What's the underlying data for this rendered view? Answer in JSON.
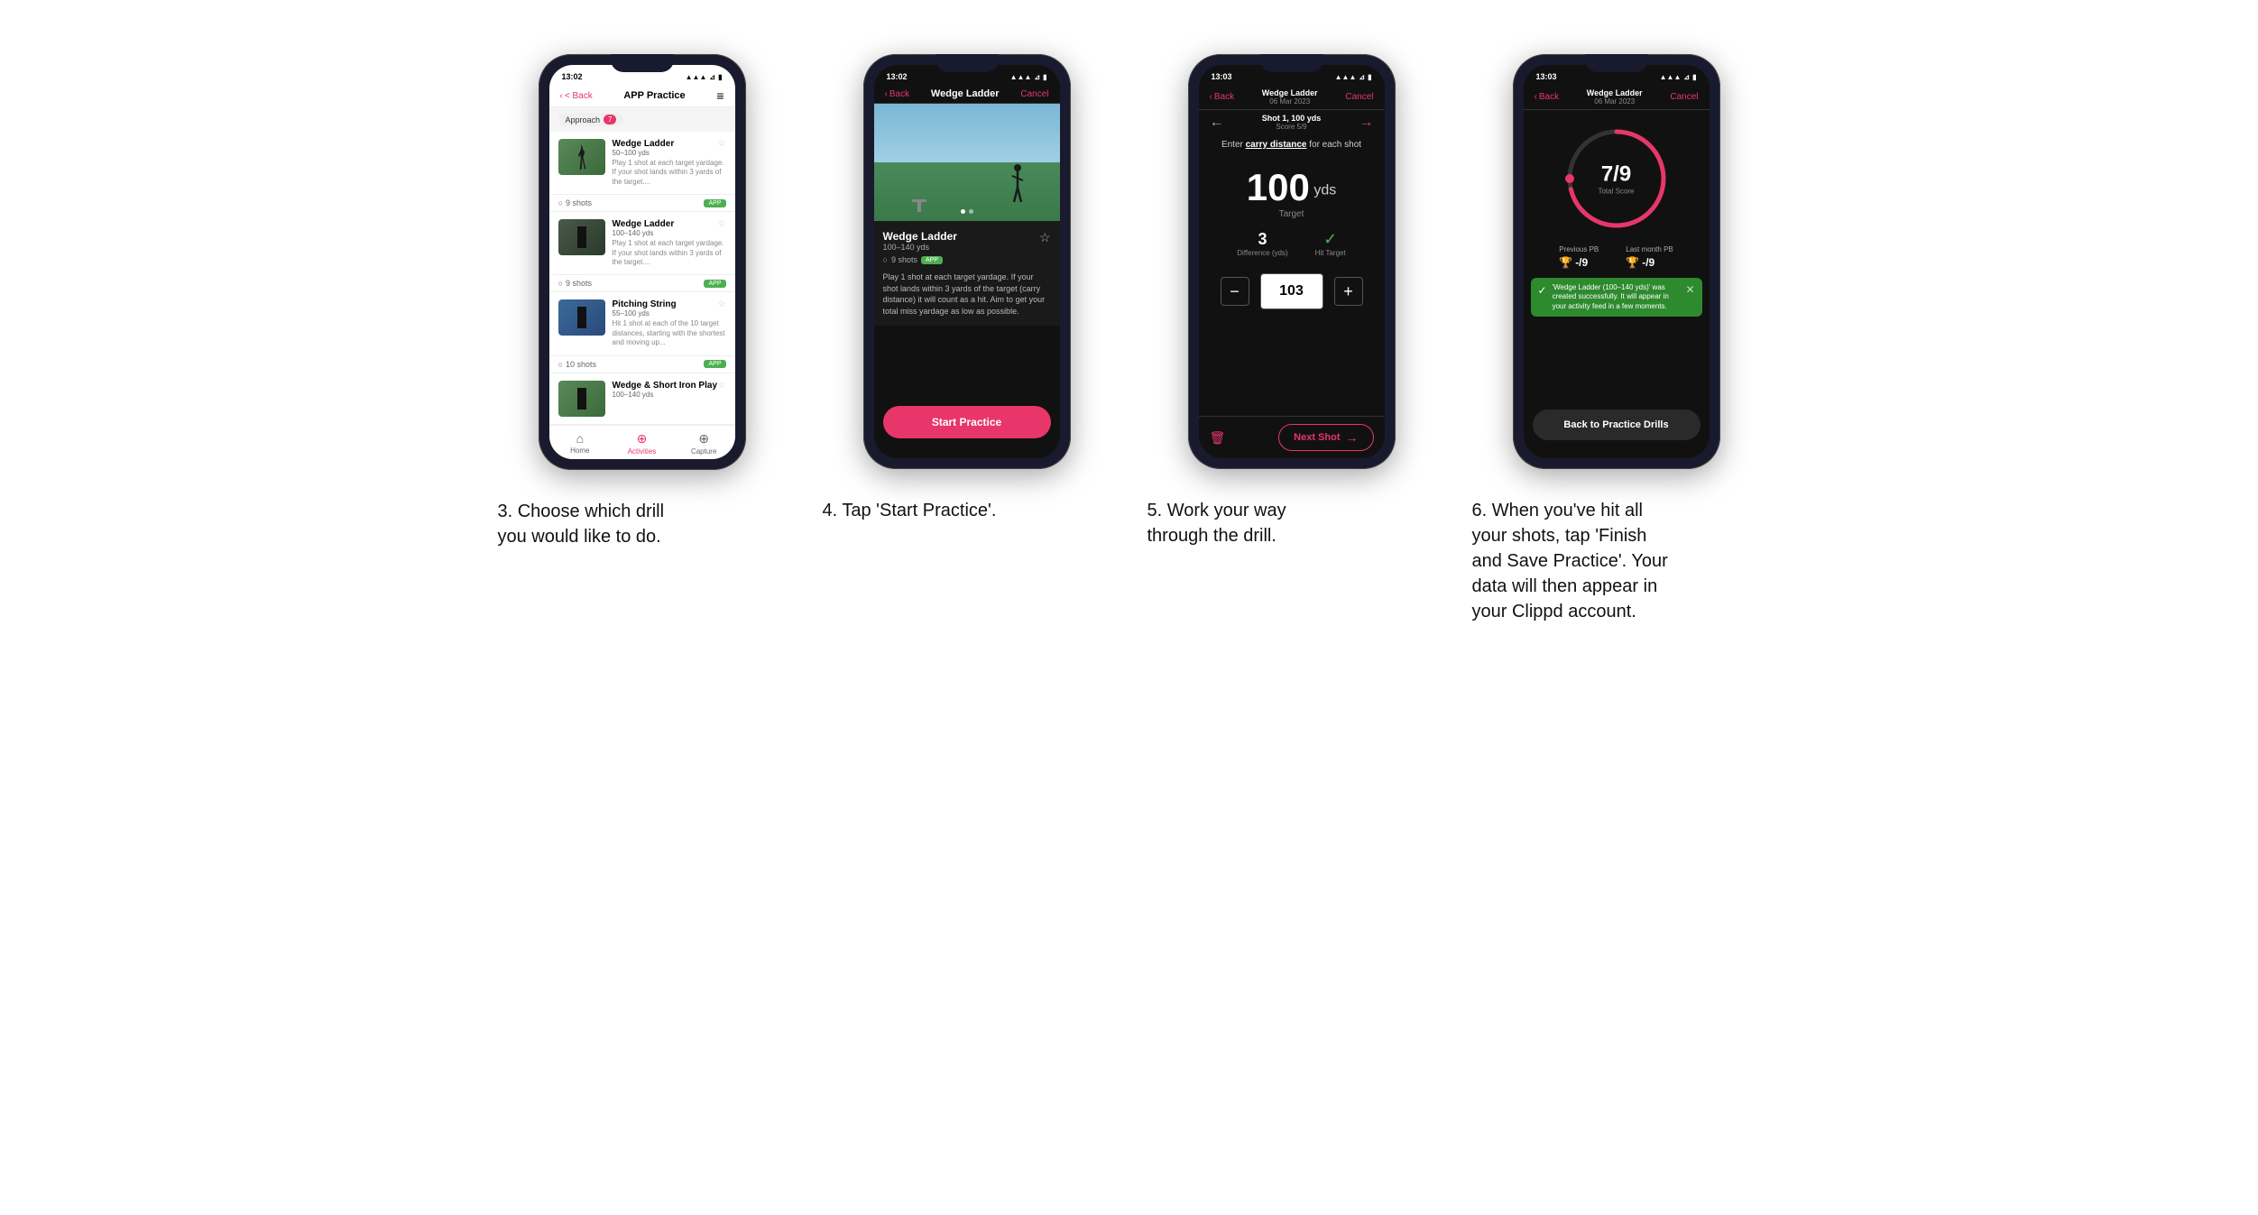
{
  "page": {
    "background": "#ffffff"
  },
  "step3": {
    "caption": "3. Choose which drill you would like to do.",
    "phone": {
      "time": "13:02",
      "nav": {
        "back": "< Back",
        "title": "APP Practice",
        "menu": "≡"
      },
      "category": {
        "label": "Approach",
        "count": "7"
      },
      "drills": [
        {
          "title": "Wedge Ladder",
          "range": "50–100 yds",
          "desc": "Play 1 shot at each target yardage. If your shot lands within 3 yards of the target....",
          "shots": "9 shots",
          "badge": "APP",
          "color": "green"
        },
        {
          "title": "Wedge Ladder",
          "range": "100–140 yds",
          "desc": "Play 1 shot at each target yardage. If your shot lands within 3 yards of the target....",
          "shots": "9 shots",
          "badge": "APP",
          "color": "dark"
        },
        {
          "title": "Pitching String",
          "range": "55–100 yds",
          "desc": "Hit 1 shot at each of the 10 target distances, starting with the shortest and moving up...",
          "shots": "10 shots",
          "badge": "APP",
          "color": "blue"
        },
        {
          "title": "Wedge & Short Iron Play",
          "range": "100–140 yds",
          "desc": "",
          "shots": "",
          "badge": "",
          "color": "green"
        }
      ],
      "bottomNav": [
        {
          "label": "Home",
          "icon": "⌂",
          "active": false
        },
        {
          "label": "Activities",
          "icon": "⊕",
          "active": true
        },
        {
          "label": "Capture",
          "icon": "⊕",
          "active": false
        }
      ]
    }
  },
  "step4": {
    "caption": "4. Tap 'Start Practice'.",
    "phone": {
      "time": "13:02",
      "nav": {
        "back": "< Back",
        "title": "Wedge Ladder",
        "action": "Cancel"
      },
      "drill": {
        "title": "Wedge Ladder",
        "range": "100–140 yds",
        "shots": "9 shots",
        "badge": "APP",
        "desc": "Play 1 shot at each target yardage. If your shot lands within 3 yards of the target (carry distance) it will count as a hit. Aim to get your total miss yardage as low as possible."
      },
      "startButton": "Start Practice"
    }
  },
  "step5": {
    "caption": "5. Work your way through the drill.",
    "phone": {
      "time": "13:03",
      "nav": {
        "back": "< Back",
        "titleLine1": "Wedge Ladder",
        "titleLine2": "06 Mar 2023",
        "action": "Cancel"
      },
      "shot": {
        "label": "Shot 1, 100 yds",
        "score": "Score 5/9"
      },
      "carryPrompt": "Enter carry distance for each shot",
      "target": "100",
      "targetUnit": "yds",
      "targetLabel": "Target",
      "difference": "3",
      "differenceLabel": "Difference (yds)",
      "hitTarget": "Hit Target",
      "inputValue": "103",
      "nextShot": "Next Shot"
    }
  },
  "step6": {
    "caption": "6. When you've hit all your shots, tap 'Finish and Save Practice'. Your data will then appear in your Clippd account.",
    "phone": {
      "time": "13:03",
      "nav": {
        "back": "< Back",
        "titleLine1": "Wedge Ladder",
        "titleLine2": "06 Mar 2023",
        "action": "Cancel"
      },
      "score": "7",
      "scoreDenom": "/9",
      "scoreLabel": "Total Score",
      "previousPB": {
        "label": "Previous PB",
        "value": "-/9"
      },
      "lastMonthPB": {
        "label": "Last month PB",
        "value": "-/9"
      },
      "successMessage": "'Wedge Ladder (100–140 yds)' was created successfully. It will appear in your activity feed in a few moments.",
      "backButton": "Back to Practice Drills"
    }
  },
  "icons": {
    "back_arrow": "‹",
    "right_arrow": "→",
    "left_arrow": "←",
    "star": "☆",
    "clock": "○",
    "check": "✓",
    "trash": "🗑",
    "wifi": "▲",
    "signal": "|||",
    "battery": "▮"
  }
}
